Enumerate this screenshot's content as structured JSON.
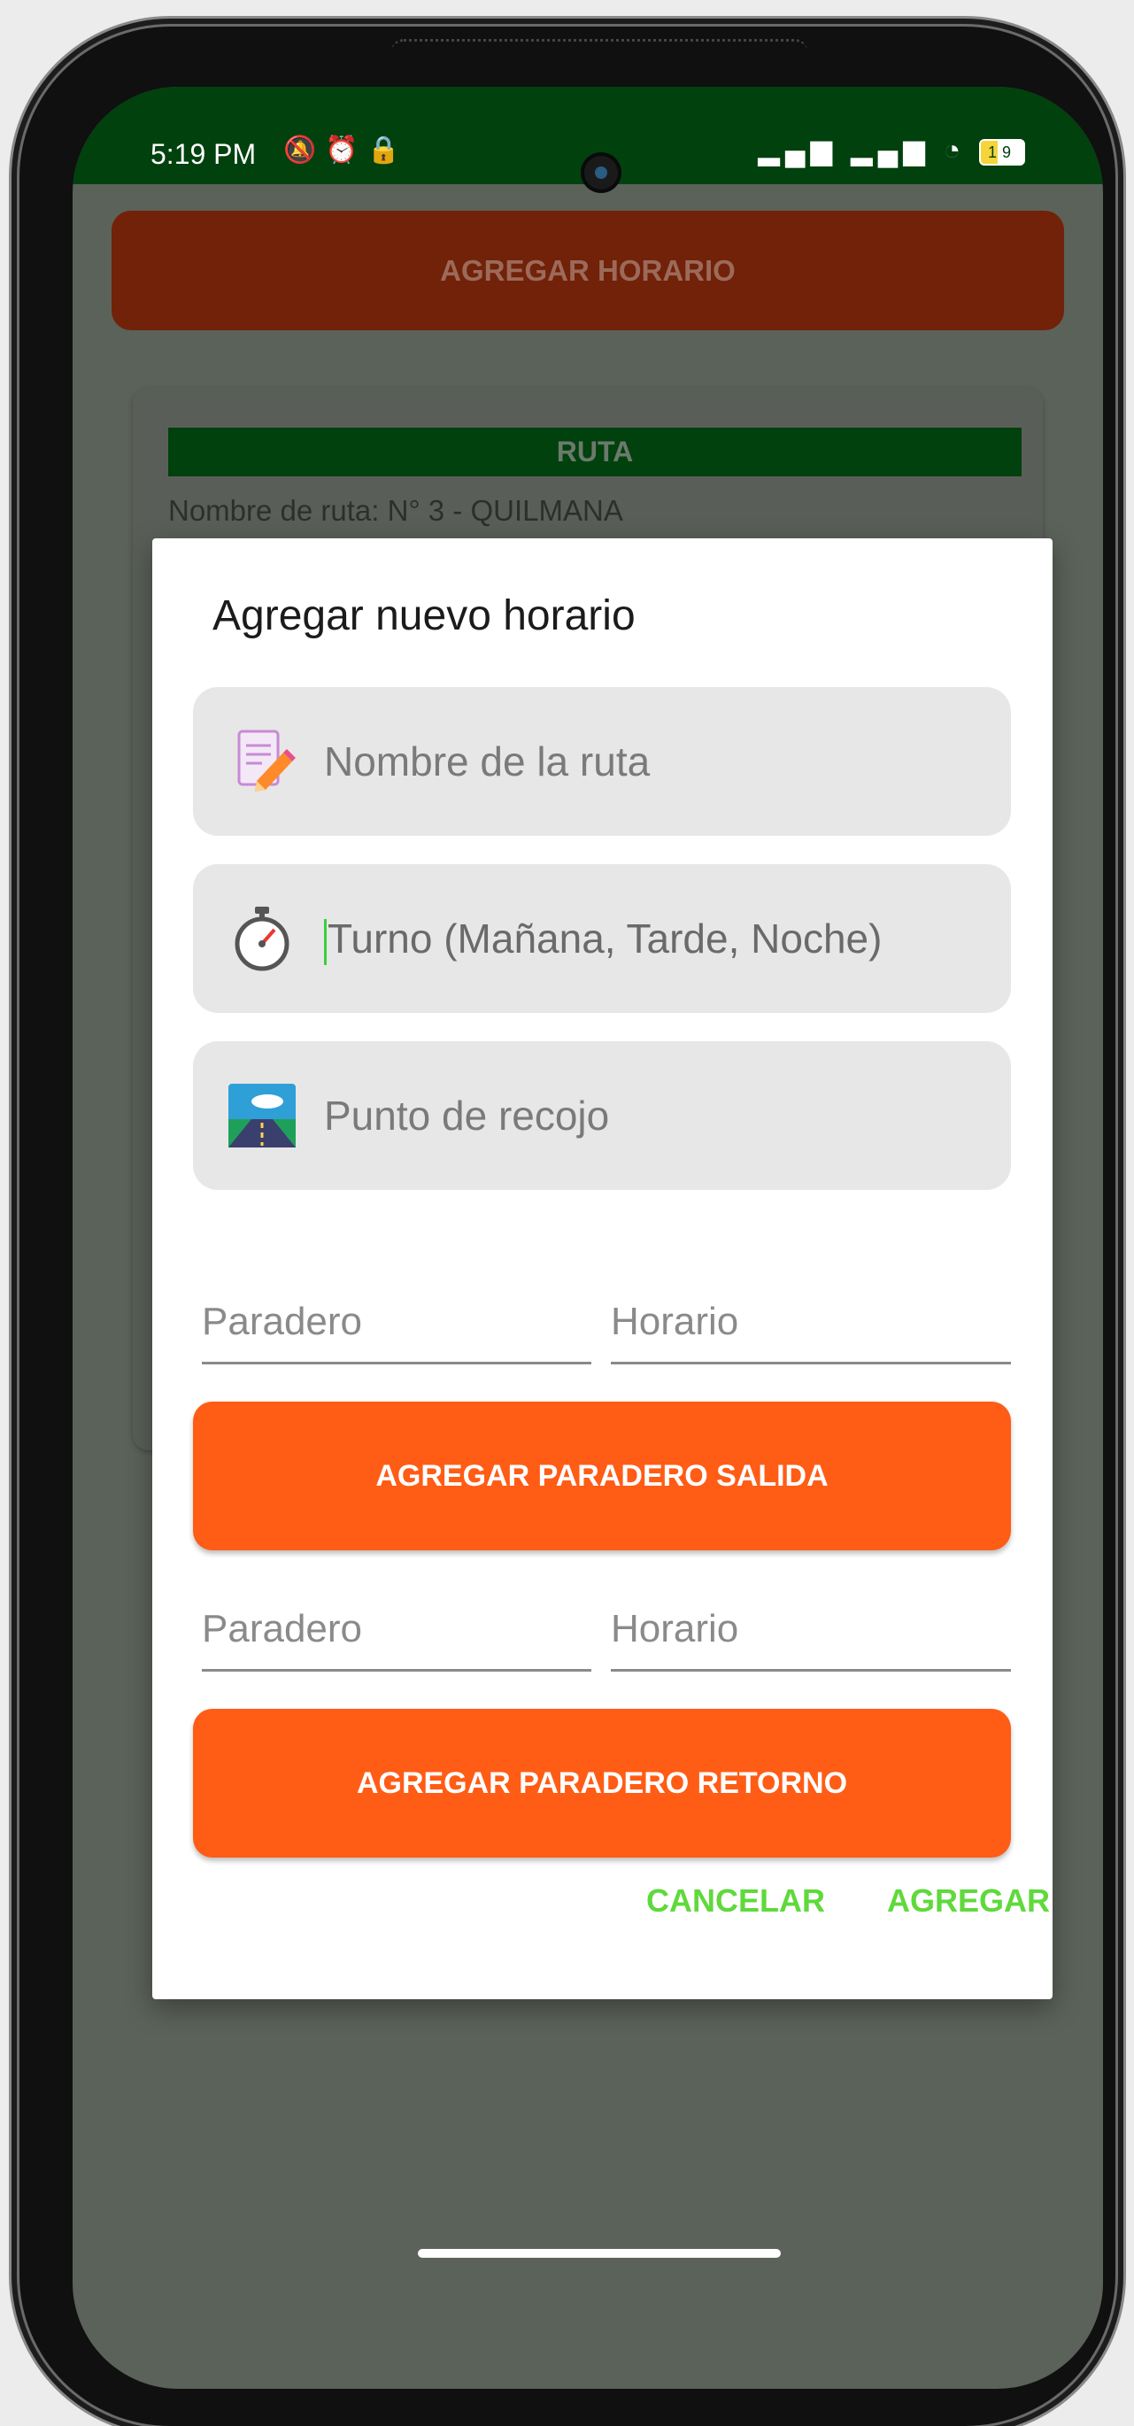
{
  "status_bar": {
    "time": "5:19 PM",
    "left_icons": "🔕 ⏰ 🔒",
    "right_icons": "📶 📶 ",
    "battery": "19"
  },
  "background": {
    "add_button_label": "AGREGAR HORARIO",
    "card_header": "RUTA",
    "card_line": "Nombre de ruta: N° 3 - QUILMANA"
  },
  "dialog": {
    "title": "Agregar nuevo horario",
    "route_name_placeholder": "Nombre de la ruta",
    "shift_placeholder": "Turno (Mañana, Tarde, Noche)",
    "pickup_placeholder": "Punto de recojo",
    "outbound_stop_placeholder": "Paradero",
    "outbound_time_placeholder": "Horario",
    "add_outbound_button": "AGREGAR PARADERO SALIDA",
    "return_stop_placeholder": "Paradero",
    "return_time_placeholder": "Horario",
    "add_return_button": "AGREGAR PARADERO RETORNO",
    "cancel_label": "CANCELAR",
    "add_label": "AGREGAR"
  },
  "colors": {
    "status_bar": "#00410e",
    "primary_button": "#ff5c16",
    "text_button": "#5fd93b"
  }
}
